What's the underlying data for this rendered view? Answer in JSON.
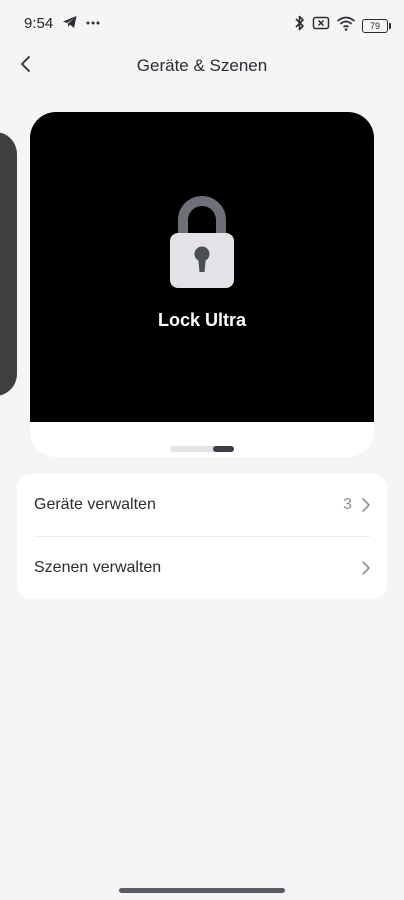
{
  "status_bar": {
    "time": "9:54",
    "battery_level": "79",
    "icons_left": [
      "telegram-icon",
      "more-notifications-icon"
    ],
    "icons_right": [
      "bluetooth-icon",
      "no-sim-icon",
      "wifi-icon",
      "battery-icon"
    ]
  },
  "header": {
    "title": "Geräte & Szenen",
    "back_icon": "chevron-left-icon"
  },
  "carousel": {
    "device_name": "Lock Ultra",
    "device_icon": "padlock-icon",
    "page_count": 2,
    "active_page": 2
  },
  "menu": {
    "items": [
      {
        "label": "Geräte verwalten",
        "count": "3",
        "icon": "chevron-right-icon"
      },
      {
        "label": "Szenen verwalten",
        "count": "",
        "icon": "chevron-right-icon"
      }
    ]
  },
  "colors": {
    "background": "#f5f5f6",
    "card": "#ffffff",
    "device_image_bg": "#000000",
    "text_primary": "#2a2d34",
    "text_secondary": "#8e9099",
    "pager_active": "#3a3d45"
  }
}
